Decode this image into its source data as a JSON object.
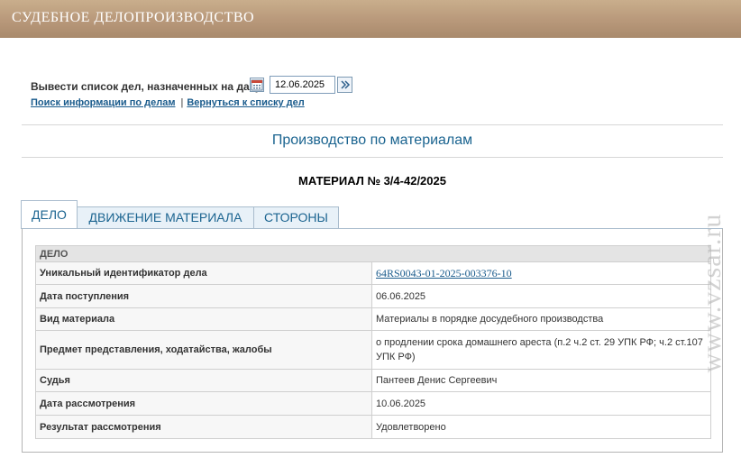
{
  "header": {
    "title": "СУДЕБНОЕ ДЕЛОПРОИЗВОДСТВО"
  },
  "date_filter": {
    "label": "Вывести список дел, назначенных на дату",
    "date_value": "12.06.2025",
    "calendar_icon": "calendar-icon",
    "go_icon": "double-chevron-right-icon"
  },
  "links": {
    "search": "Поиск информации по делам",
    "separator": "|",
    "back": "Вернуться к списку дел"
  },
  "section_title": "Производство по материалам",
  "material_title": "МАТЕРИАЛ № 3/4-42/2025",
  "tabs": [
    {
      "label": "ДЕЛО",
      "active": true
    },
    {
      "label": "ДВИЖЕНИЕ МАТЕРИАЛА",
      "active": false
    },
    {
      "label": "СТОРОНЫ",
      "active": false
    }
  ],
  "case_table": {
    "header": "ДЕЛО",
    "rows": [
      {
        "label": "Уникальный идентификатор дела",
        "value": "64RS0043-01-2025-003376-10"
      },
      {
        "label": "Дата поступления",
        "value": "06.06.2025"
      },
      {
        "label": "Вид материала",
        "value": "Материалы в порядке досудебного производства"
      },
      {
        "label": "Предмет представления, ходатайства, жалобы",
        "value": "о продлении срока домашнего ареста (п.2 ч.2 ст. 29 УПК РФ; ч.2 ст.107 УПК РФ)"
      },
      {
        "label": "Судья",
        "value": "Пантеев Денис Сергеевич"
      },
      {
        "label": "Дата рассмотрения",
        "value": "10.06.2025"
      },
      {
        "label": "Результат рассмотрения",
        "value": "Удовлетворено"
      }
    ]
  },
  "watermark": "www.vzsar.ru",
  "colors": {
    "header_bg": "#b8987a",
    "link": "#1a5b8c",
    "title": "#1b6490"
  }
}
